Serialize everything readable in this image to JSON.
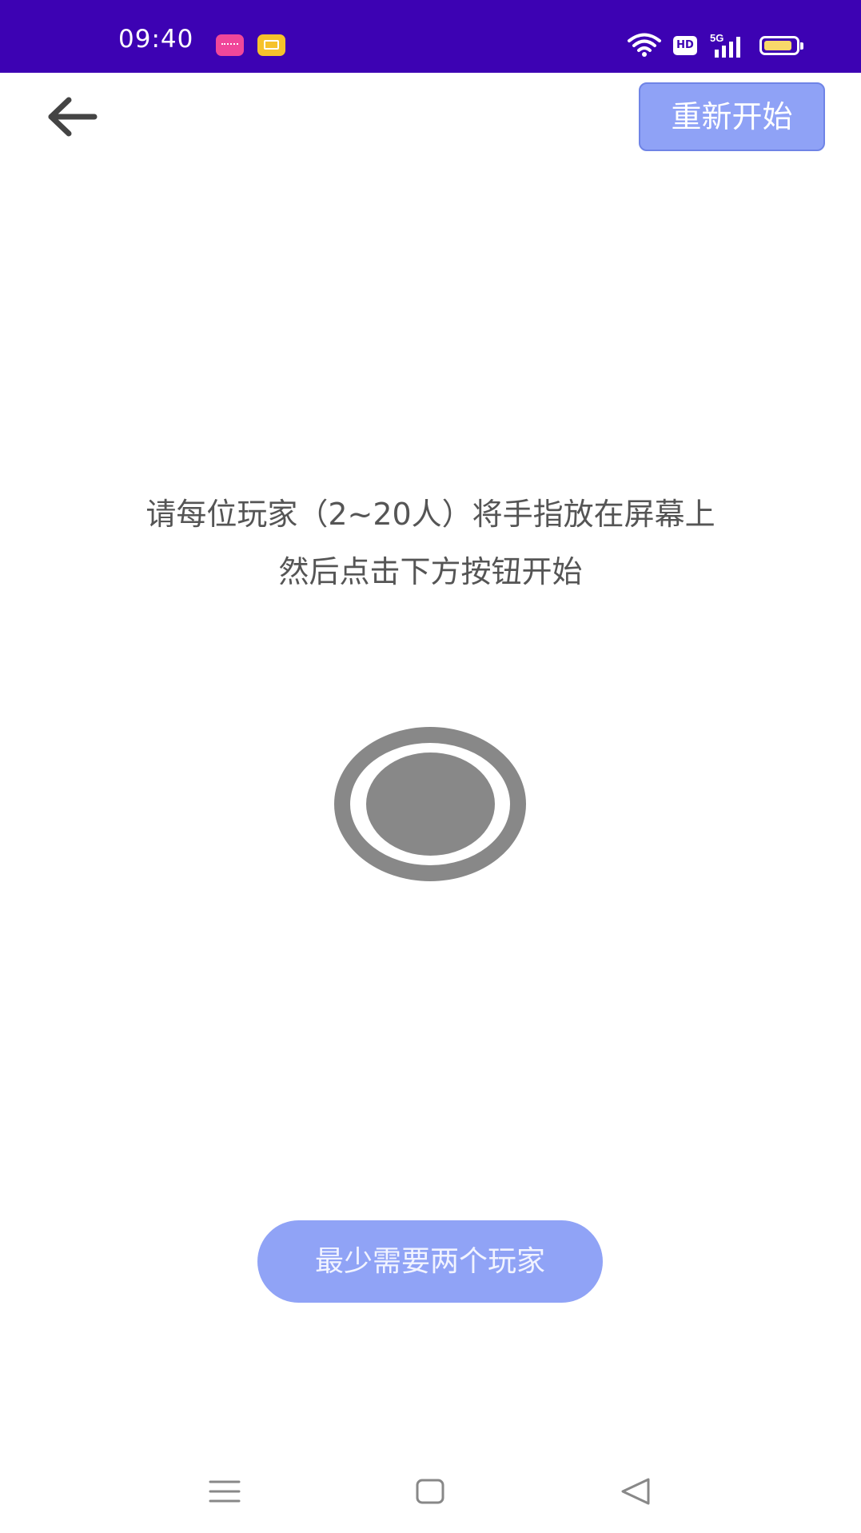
{
  "status_bar": {
    "time": "09:40",
    "notification_icons": [
      "pink-app-icon",
      "mail-icon"
    ],
    "network_badge": "HD",
    "signal_label": "5G",
    "background_color": "#3d02b3"
  },
  "top_bar": {
    "back_icon": "arrow-left-icon",
    "restart_label": "重新开始"
  },
  "instructions": {
    "line1": "请每位玩家（2~20人）将手指放在屏幕上",
    "line2": "然后点击下方按钮开始"
  },
  "touch_indicator": {
    "icon": "finger-touch-circle-icon",
    "color": "#888888"
  },
  "start_button": {
    "label": "最少需要两个玩家",
    "color": "#90a3f6"
  },
  "nav_bar": {
    "menu_icon": "menu-icon",
    "home_icon": "home-icon",
    "back_icon": "back-triangle-icon"
  }
}
